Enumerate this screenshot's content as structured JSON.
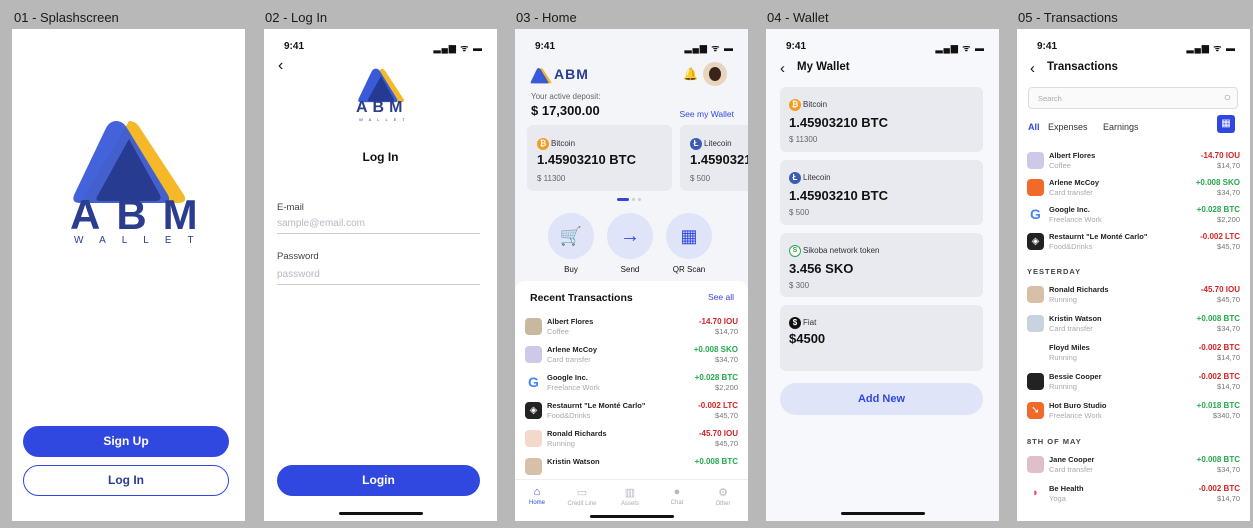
{
  "frames": {
    "f1": "01 - Splashscreen",
    "f2": "02 - Log In",
    "f3": "03 - Home",
    "f4": "04 - Wallet",
    "f5": "05 - Transactions"
  },
  "status_time": "9:41",
  "status_icons": "▂▄▆ ᯤ ▬",
  "brand": {
    "name": "ABM",
    "sub": "WALLET"
  },
  "colors": {
    "primary": "#3148e0",
    "logo_blue": "#3a5bd8",
    "logo_yellow": "#f4b828",
    "negative": "#d42424",
    "positive": "#25a94a"
  },
  "splash": {
    "signup": "Sign Up",
    "login": "Log In"
  },
  "login": {
    "back_icon": "chevron-left-icon",
    "title": "Log In",
    "email_label": "E-mail",
    "email_placeholder": "sample@email.com",
    "password_label": "Password",
    "password_placeholder": "password",
    "submit": "Login"
  },
  "home": {
    "deposit_label": "Your active deposit:",
    "deposit_value": "$ 17,300.00",
    "see_wallet": "See my Wallet",
    "cards": [
      {
        "coin": "Bitcoin",
        "amount": "1.45903210 BTC",
        "fiat": "$ 11300"
      },
      {
        "coin": "Litecoin",
        "amount": "1.4590321",
        "fiat": "$ 500"
      }
    ],
    "actions": [
      {
        "label": "Buy",
        "icon": "cart-icon"
      },
      {
        "label": "Send",
        "icon": "arrow-right-icon"
      },
      {
        "label": "QR Scan",
        "icon": "qr-icon"
      }
    ],
    "recent_title": "Recent Transactions",
    "see_all": "See all",
    "transactions": [
      {
        "name": "Albert Flores",
        "cat": "Coffee",
        "amt": "-14.70 IOU",
        "fiat": "$14,70",
        "sign": "neg"
      },
      {
        "name": "Arlene McCoy",
        "cat": "Card transfer",
        "amt": "+0.008 SKO",
        "fiat": "$34,70",
        "sign": "pos"
      },
      {
        "name": "Google Inc.",
        "cat": "Freelance Work",
        "amt": "+0.028 BTC",
        "fiat": "$2,200",
        "sign": "pos"
      },
      {
        "name": "Restaurnt \"Le Monté Carlo\"",
        "cat": "Food&Drinks",
        "amt": "-0.002 LTC",
        "fiat": "$45,70",
        "sign": "neg"
      },
      {
        "name": "Ronald Richards",
        "cat": "Running",
        "amt": "-45.70 IOU",
        "fiat": "$45,70",
        "sign": "neg"
      },
      {
        "name": "Kristin Watson",
        "cat": "",
        "amt": "+0.008 BTC",
        "fiat": "",
        "sign": "pos"
      }
    ],
    "tabs": [
      "Home",
      "Credit Line",
      "Assets",
      "Chat",
      "Other"
    ]
  },
  "wallet": {
    "title": "My Wallet",
    "cards": [
      {
        "coin": "Bitcoin",
        "amount": "1.45903210 BTC",
        "fiat": "$ 11300",
        "kind": "btc"
      },
      {
        "coin": "Litecoin",
        "amount": "1.45903210 BTC",
        "fiat": "$ 500",
        "kind": "ltc"
      },
      {
        "coin": "Sikoba network token",
        "amount": "3.456 SKO",
        "fiat": "$ 300",
        "kind": "sko"
      },
      {
        "coin": "Fiat",
        "amount": "$4500",
        "fiat": "",
        "kind": "fiat"
      }
    ],
    "add_new": "Add New"
  },
  "transactions": {
    "title": "Transactions",
    "search_placeholder": "Search",
    "filters": [
      "All",
      "Expenses",
      "Earnings"
    ],
    "today": [
      {
        "name": "Albert Flores",
        "cat": "Coffee",
        "amt": "-14.70 IOU",
        "fiat": "$14,70",
        "sign": "neg"
      },
      {
        "name": "Arlene McCoy",
        "cat": "Card transfer",
        "amt": "+0.008 SKO",
        "fiat": "$34,70",
        "sign": "pos"
      },
      {
        "name": "Google Inc.",
        "cat": "Freelance Work",
        "amt": "+0.028 BTC",
        "fiat": "$2,200",
        "sign": "pos"
      },
      {
        "name": "Restaurnt \"Le Monté Carlo\"",
        "cat": "Food&Drinks",
        "amt": "-0.002 LTC",
        "fiat": "$45,70",
        "sign": "neg"
      }
    ],
    "yesterday_label": "YESTERDAY",
    "yesterday": [
      {
        "name": "Ronald Richards",
        "cat": "Running",
        "amt": "-45.70 IOU",
        "fiat": "$45,70",
        "sign": "neg"
      },
      {
        "name": "Kristin Watson",
        "cat": "Card transfer",
        "amt": "+0.008 BTC",
        "fiat": "$34,70",
        "sign": "pos"
      },
      {
        "name": "Floyd Miles",
        "cat": "Running",
        "amt": "-0.002 BTC",
        "fiat": "$14,70",
        "sign": "neg"
      },
      {
        "name": "Bessie Cooper",
        "cat": "Running",
        "amt": "-0.002 BTC",
        "fiat": "$14,70",
        "sign": "neg"
      },
      {
        "name": "Hot Buro Studio",
        "cat": "Freelance Work",
        "amt": "+0.018 BTC",
        "fiat": "$340,70",
        "sign": "pos"
      }
    ],
    "may_label": "8TH OF MAY",
    "may": [
      {
        "name": "Jane Cooper",
        "cat": "Card transfer",
        "amt": "+0.008 BTC",
        "fiat": "$34,70",
        "sign": "pos"
      },
      {
        "name": "Be Health",
        "cat": "Yoga",
        "amt": "-0.002 BTC",
        "fiat": "$14,70",
        "sign": "neg"
      }
    ]
  }
}
